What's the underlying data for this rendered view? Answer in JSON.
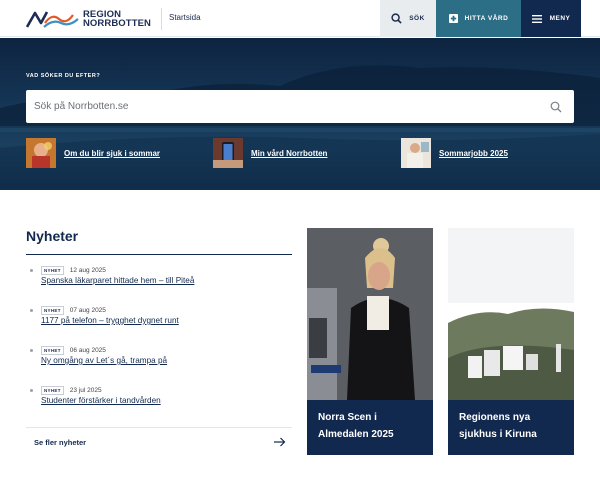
{
  "header": {
    "logo_line1": "REGION",
    "logo_line2": "NORRBOTTEN",
    "breadcrumb": "Startsida",
    "search_label": "SÖK",
    "care_label": "HITTA VÅRD",
    "menu_label": "MENY",
    "colors": {
      "care_bg": "#2c6e86",
      "menu_bg": "#12294f",
      "search_bg": "#e9ecef"
    }
  },
  "hero": {
    "search_heading": "VAD SÖKER DU EFTER?",
    "search_placeholder": "Sök på Norrbotten.se",
    "quick_links": [
      {
        "label": "Om du blir sjuk i sommar"
      },
      {
        "label": "Min vård Norrbotten"
      },
      {
        "label": "Sommarjobb 2025"
      }
    ]
  },
  "news": {
    "title": "Nyheter",
    "items": [
      {
        "badge": "NYHET",
        "date": "12 aug 2025",
        "title": "Spanska läkarparet hittade hem – till Piteå"
      },
      {
        "badge": "NYHET",
        "date": "07 aug 2025",
        "title": "1177 på telefon – trygghet dygnet runt"
      },
      {
        "badge": "NYHET",
        "date": "06 aug 2025",
        "title": "Ny omgång av Let´s gå, trampa på"
      },
      {
        "badge": "NYHET",
        "date": "23 jul 2025",
        "title": "Studenter förstärker i tandvården"
      }
    ],
    "see_more": "Se fler nyheter"
  },
  "cards": [
    {
      "line1": "Norra Scen i",
      "line2": "Almedalen 2025"
    },
    {
      "line1": "Regionens nya",
      "line2": "sjukhus i Kiruna"
    }
  ]
}
